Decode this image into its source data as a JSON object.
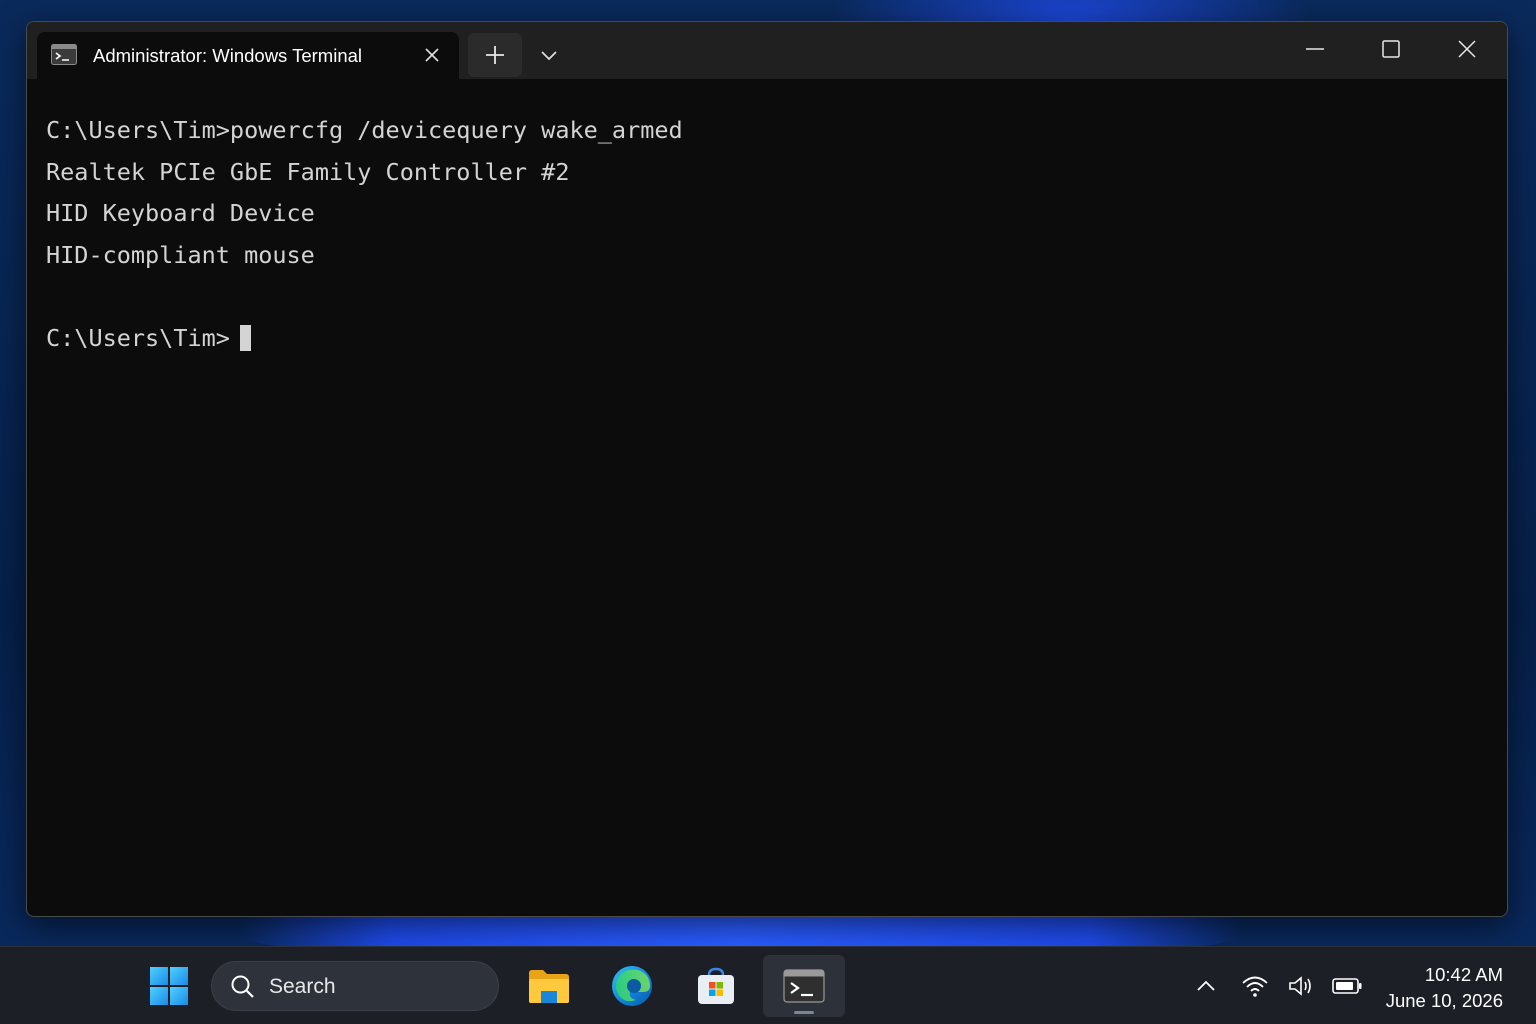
{
  "window": {
    "tab_title": "Administrator: Windows Terminal",
    "icons": {
      "tab": "terminal-icon",
      "tab_close": "close-icon",
      "new_tab": "plus-icon",
      "dropdown": "chevron-down-icon",
      "minimize": "minimize-icon",
      "maximize": "maximize-icon",
      "close": "close-icon"
    }
  },
  "terminal": {
    "lines": [
      "C:\\Users\\Tim>powercfg /devicequery wake_armed",
      "Realtek PCIe GbE Family Controller #2",
      "HID Keyboard Device",
      "HID-compliant mouse",
      "",
      "C:\\Users\\Tim>"
    ],
    "colors": {
      "background": "#0c0c0c",
      "foreground": "#d4d4d4"
    }
  },
  "taskbar": {
    "search_label": "Search",
    "apps": [
      "start-icon",
      "file-explorer-icon",
      "edge-icon",
      "store-icon",
      "terminal-icon"
    ],
    "tray": [
      "chevron-up-icon",
      "wifi-icon",
      "volume-icon",
      "battery-icon"
    ],
    "clock": {
      "time": "10:42 AM",
      "date": "June 10, 2026"
    }
  }
}
